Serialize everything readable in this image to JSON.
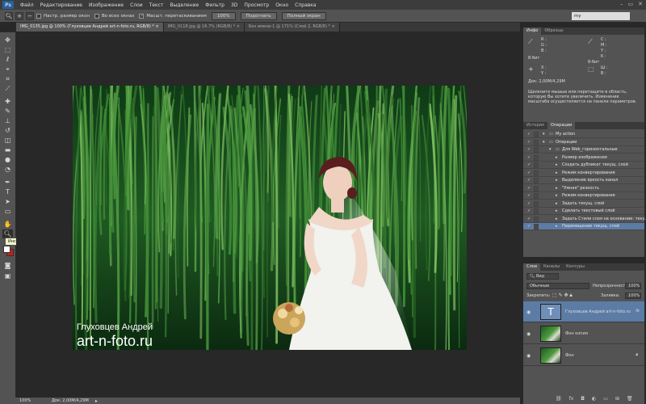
{
  "app": {
    "logo": "Ps"
  },
  "menu": [
    "Файл",
    "Редактирование",
    "Изображение",
    "Слои",
    "Текст",
    "Выделение",
    "Фильтр",
    "3D",
    "Просмотр",
    "Окно",
    "Справка"
  ],
  "window_controls": [
    "–",
    "▭",
    "✕"
  ],
  "options": {
    "tool_icon": "zoom-icon",
    "check1_label": "Настр. размер окон",
    "check2_label": "Во всех окнах",
    "check3_label": "Масшт. перетаскиванием",
    "btn100": "100%",
    "btn_fit": "Подогнать",
    "btn_full": "Полный экран",
    "workspace": "my"
  },
  "tabs": [
    {
      "label": "IMG_0135.jpg @ 100% (Глуховцев Андрей art-n-foto.ru, RGB/8) *  ×",
      "active": true
    },
    {
      "label": "IMG_0118.jpg @ 16.7% (RGB/8) *  ×",
      "active": false
    },
    {
      "label": "Без имени-1 @ 171% (Слой 2, RGB/8) *  ×",
      "active": false
    }
  ],
  "tooltip": "Инструмент \"Масштаб\" (Z)",
  "photo": {
    "name": "Глуховцев Андрей",
    "site": "art-n-foto.ru"
  },
  "status": {
    "zoom": "100%",
    "doc": "Док: 2,00М/4,29М"
  },
  "info": {
    "tabs": [
      "Инфо",
      "Образцы"
    ],
    "r": "R :",
    "g": "G :",
    "b": "B :",
    "c": "C :",
    "m": "M :",
    "y": "Y :",
    "k": "K :",
    "bit1": "8-бит",
    "bit2": "8-бит",
    "x": "X :",
    "y2": "Y :",
    "w": "Ш :",
    "h": "В :",
    "doc": "Док: 2,00М/4,29М",
    "hint": "Щелкните мышью или перетащите в область, которую Вы хотите увеличить. Изменение масштаба осуществляется на панели параметров."
  },
  "actions": {
    "tabs": [
      "История",
      "Операции"
    ],
    "rows": [
      {
        "label": "My action",
        "level": 0,
        "sel": false
      },
      {
        "label": "Операции",
        "level": 0,
        "sel": false
      },
      {
        "label": "Для Web_горизонтальные",
        "level": 1,
        "sel": false
      },
      {
        "label": "Размер изображения",
        "level": 2,
        "sel": false
      },
      {
        "label": "Создать дубликат текущ. слой",
        "level": 2,
        "sel": false
      },
      {
        "label": "Режим конвертирования",
        "level": 2,
        "sel": false
      },
      {
        "label": "Выделение яркость канал",
        "level": 2,
        "sel": false
      },
      {
        "label": "\"Умная\" резкость",
        "level": 2,
        "sel": false
      },
      {
        "label": "Режим конвертирования",
        "level": 2,
        "sel": false
      },
      {
        "label": "Задать текущ. слой",
        "level": 2,
        "sel": false
      },
      {
        "label": "Сделать текстовый слой",
        "level": 2,
        "sel": false
      },
      {
        "label": "Задать Стили слоя на основании: теку...",
        "level": 2,
        "sel": false
      },
      {
        "label": "Перемещение текущ. слой",
        "level": 2,
        "sel": true
      }
    ]
  },
  "layers": {
    "tabs": [
      "Слои",
      "Каналы",
      "Контуры"
    ],
    "kind": "Вид",
    "blend": "Обычные",
    "opacity_label": "Непрозрачность:",
    "opacity": "100%",
    "lock_label": "Закрепить:",
    "fill_label": "Заливка:",
    "fill": "100%",
    "items": [
      {
        "name": "Глуховцев Андрей art-n-foto.ru",
        "type": "text",
        "sel": true,
        "fx": "fx"
      },
      {
        "name": "Фон копия",
        "type": "image",
        "sel": false,
        "fx": ""
      },
      {
        "name": "Фон",
        "type": "image",
        "sel": false,
        "fx": ""
      }
    ],
    "bottom_icons": [
      "link-icon",
      "fx-icon",
      "mask-icon",
      "adjustment-icon",
      "folder-icon",
      "new-layer-icon",
      "trash-icon"
    ]
  }
}
